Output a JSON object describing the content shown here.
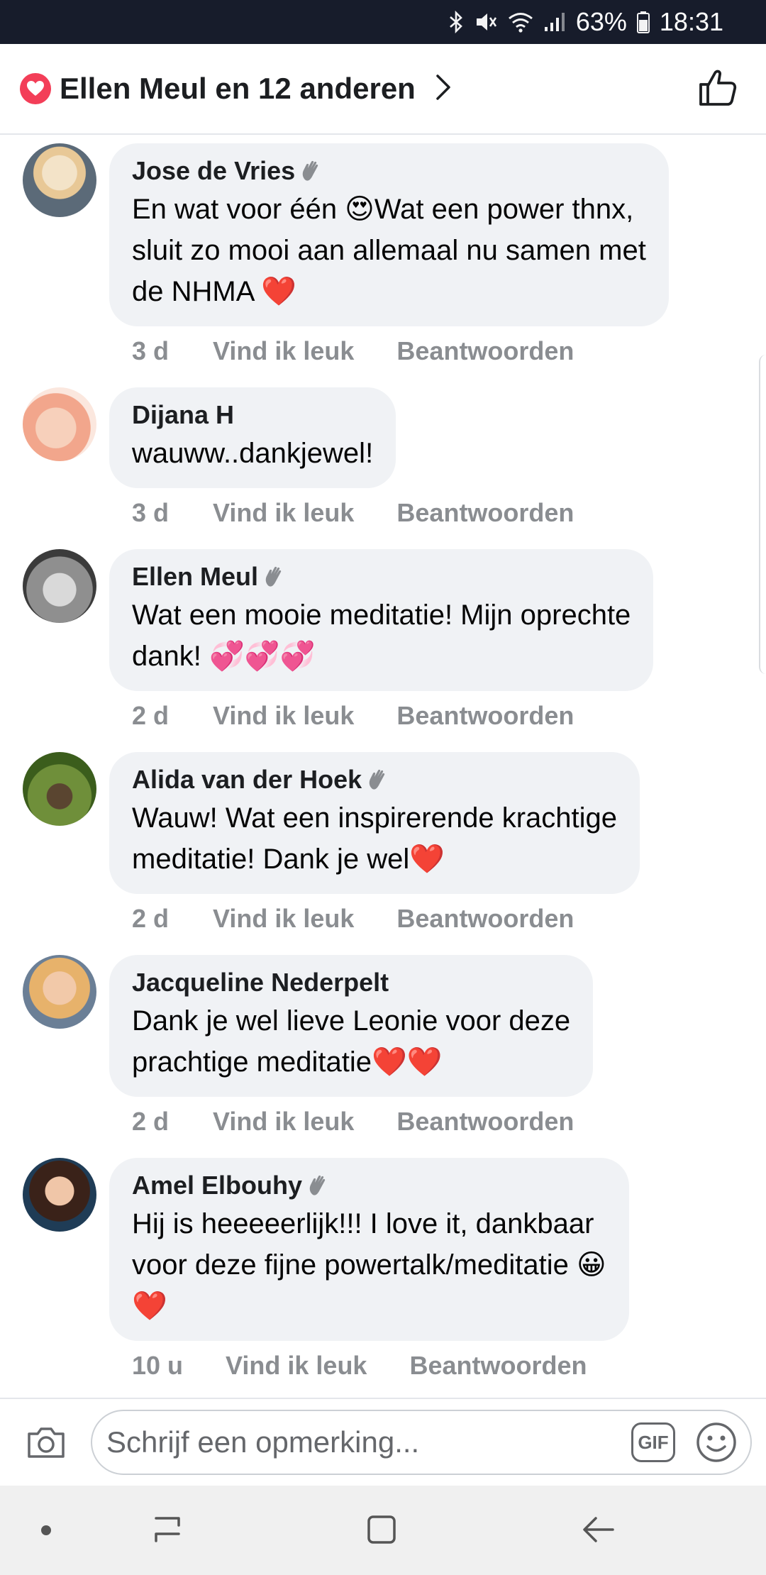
{
  "status_bar": {
    "battery": "63%",
    "time": "18:31"
  },
  "header": {
    "reactions_text": "Ellen Meul en 12 anderen"
  },
  "comments": [
    {
      "author": "Jose de Vries",
      "lines": [
        "En wat voor één 😍Wat een power thnx,",
        "sluit zo mooi aan allemaal nu samen met",
        "de NHMA ❤️"
      ],
      "time": "3 d",
      "like": "Vind ik leuk",
      "reply": "Beantwoorden"
    },
    {
      "author": "Dijana H",
      "lines": [
        "wauww..dankjewel!"
      ],
      "time": "3 d",
      "like": "Vind ik leuk",
      "reply": "Beantwoorden"
    },
    {
      "author": "Ellen Meul",
      "lines": [
        "Wat een mooie meditatie! Mijn oprechte",
        "dank! 💞💞💞"
      ],
      "time": "2 d",
      "like": "Vind ik leuk",
      "reply": "Beantwoorden"
    },
    {
      "author": "Alida van der Hoek",
      "lines": [
        "Wauw! Wat een inspirerende krachtige",
        "meditatie! Dank je wel❤️"
      ],
      "time": "2 d",
      "like": "Vind ik leuk",
      "reply": "Beantwoorden"
    },
    {
      "author": "Jacqueline Nederpelt",
      "lines": [
        "Dank je wel lieve Leonie voor deze",
        "prachtige meditatie❤️❤️"
      ],
      "time": "2 d",
      "like": "Vind ik leuk",
      "reply": "Beantwoorden"
    },
    {
      "author": "Amel Elbouhy",
      "lines": [
        "Hij is heeeeerlijk!!! I love it, dankbaar",
        "voor deze fijne powertalk/meditatie 😀",
        "❤️"
      ],
      "time": "10 u",
      "like": "Vind ik leuk",
      "reply": "Beantwoorden"
    }
  ],
  "composer": {
    "placeholder": "Schrijf een opmerking...",
    "gif_label": "GIF"
  },
  "icons": {
    "reaction": "heart-icon",
    "header_action": "thumbs-up-icon",
    "author_badge": "waving-hand-icon",
    "camera": "camera-icon",
    "emoji": "smiley-icon"
  },
  "colors": {
    "heart": "#f33e58",
    "bubble": "#f0f2f5",
    "meta_text": "#8a8d91",
    "status_bar": "#171c2b"
  }
}
